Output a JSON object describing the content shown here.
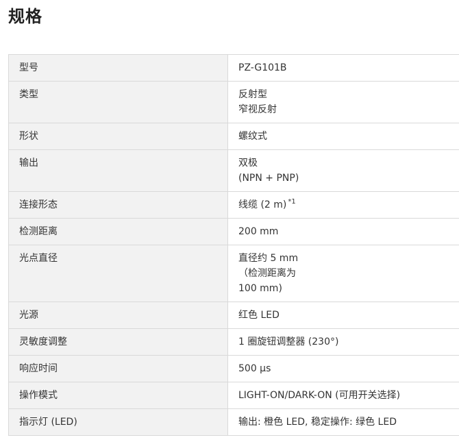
{
  "title": "规格",
  "rows": [
    {
      "label": "型号",
      "value": [
        "PZ-G101B"
      ]
    },
    {
      "label": "类型",
      "value": [
        "反射型",
        "窄视反射"
      ]
    },
    {
      "label": "形状",
      "value": [
        "螺纹式"
      ]
    },
    {
      "label": "输出",
      "value": [
        "双极",
        "(NPN + PNP)"
      ]
    },
    {
      "label": "连接形态",
      "value": [
        "线缆 (2 m)"
      ],
      "note": "*1"
    },
    {
      "label": "检测距离",
      "value": [
        "200 mm"
      ]
    },
    {
      "label": "光点直径",
      "value": [
        "直径约 5 mm",
        "（检测距离为",
        "100 mm)"
      ]
    },
    {
      "label": "光源",
      "value": [
        "红色 LED"
      ]
    },
    {
      "label": "灵敏度调整",
      "value": [
        "1 圈旋钮调整器 (230°)"
      ]
    },
    {
      "label": "响应时间",
      "value": [
        "500 µs"
      ]
    },
    {
      "label": "操作模式",
      "value": [
        "LIGHT-ON/DARK-ON (可用开关选择)"
      ]
    },
    {
      "label": "指示灯 (LED)",
      "value": [
        "输出: 橙色 LED, 稳定操作: 绿色 LED"
      ]
    }
  ]
}
